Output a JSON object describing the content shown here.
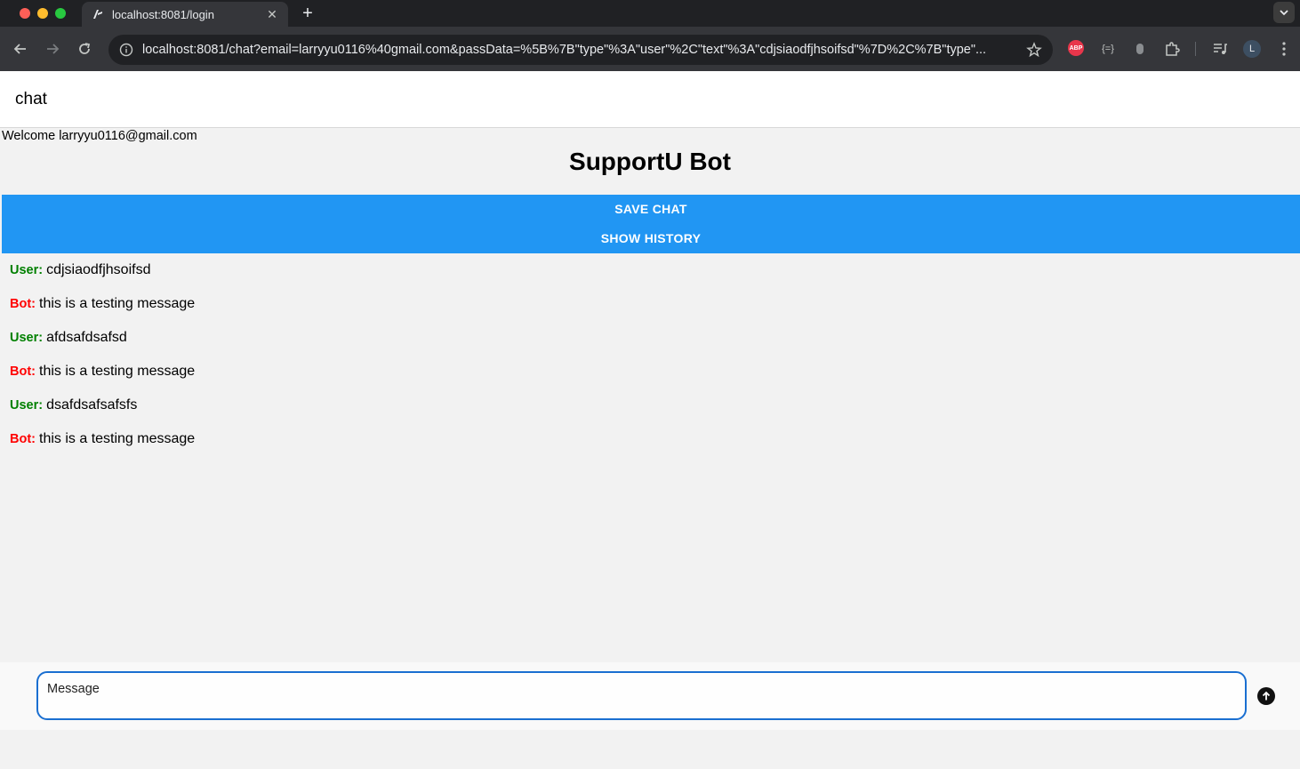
{
  "browser": {
    "tab_title": "localhost:8081/login",
    "new_tab_label": "+",
    "url": "localhost:8081/chat?email=larryyu0116%40gmail.com&passData=%5B%7B\"type\"%3A\"user\"%2C\"text\"%3A\"cdjsiaodfjhsoifsd\"%7D%2C%7B\"type\"...",
    "abp_label": "ABP",
    "ext2_label": "{=}",
    "profile_initial": "L"
  },
  "app": {
    "header_title": "chat",
    "welcome": "Welcome larryyu0116@gmail.com",
    "bot_title": "SupportU Bot",
    "save_chat_label": "SAVE CHAT",
    "show_history_label": "SHOW HISTORY",
    "messages": [
      {
        "speaker": "User:",
        "text": "cdjsiaodfjhsoifsd",
        "role": "user"
      },
      {
        "speaker": "Bot:",
        "text": "this is a testing message",
        "role": "bot"
      },
      {
        "speaker": "User:",
        "text": "afdsafdsafsd",
        "role": "user"
      },
      {
        "speaker": "Bot:",
        "text": "this is a testing message",
        "role": "bot"
      },
      {
        "speaker": "User:",
        "text": "dsafdsafsafsfs",
        "role": "user"
      },
      {
        "speaker": "Bot:",
        "text": "this is a testing message",
        "role": "bot"
      }
    ],
    "message_placeholder": "Message"
  },
  "colors": {
    "accent_button": "#2196f3",
    "user_label": "#008000",
    "bot_label": "#ff0000",
    "input_border": "#1a6fd1"
  }
}
